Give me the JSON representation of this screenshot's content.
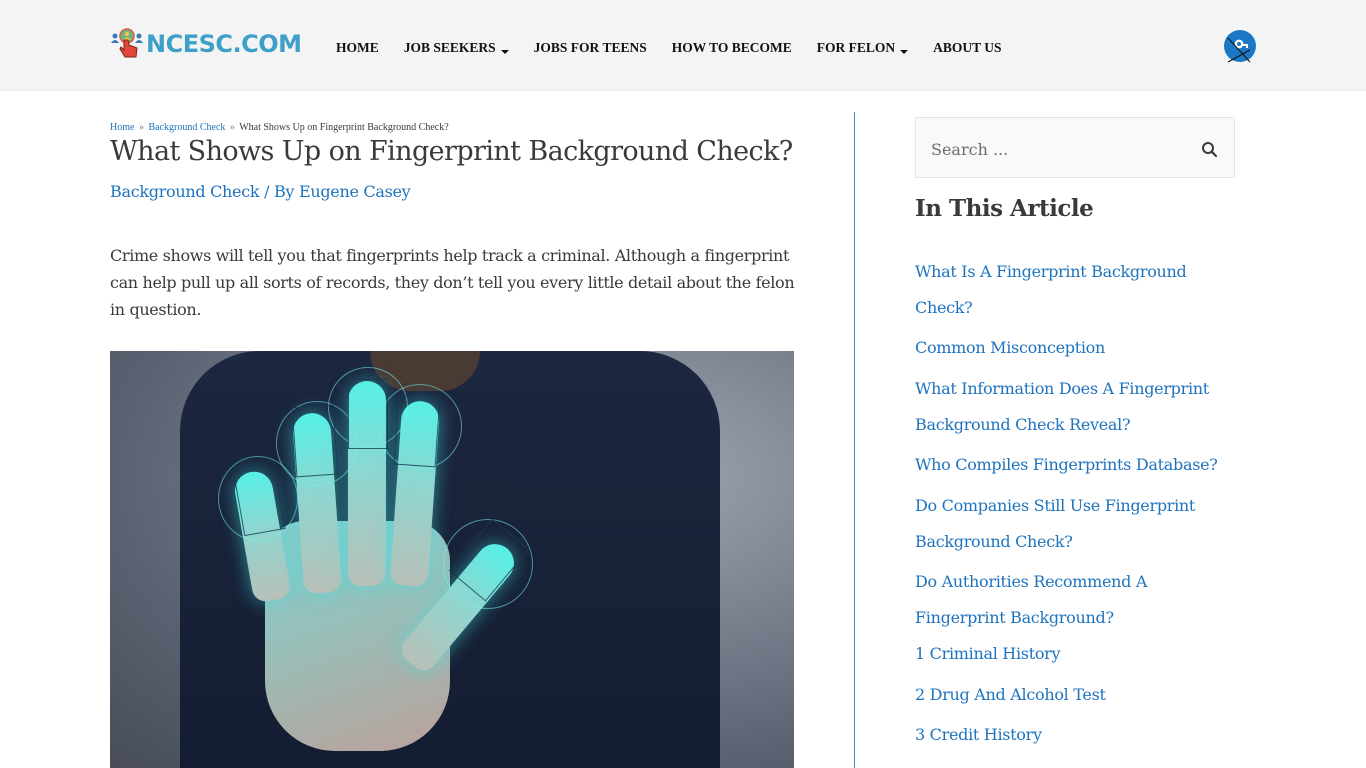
{
  "site": {
    "logo_text": "NCESC.COM",
    "brand_color": "#3ea0c9",
    "link_color": "#1e73be"
  },
  "nav": {
    "items": [
      {
        "label": "HOME",
        "has_dropdown": false
      },
      {
        "label": "JOB SEEKERS",
        "has_dropdown": true
      },
      {
        "label": "JOBS FOR TEENS",
        "has_dropdown": false
      },
      {
        "label": "HOW TO BECOME",
        "has_dropdown": false
      },
      {
        "label": "FOR FELON",
        "has_dropdown": true
      },
      {
        "label": "ABOUT US",
        "has_dropdown": false
      }
    ],
    "account_icon": "user-account-icon"
  },
  "breadcrumb": {
    "items": [
      "Home",
      "Background Check",
      "What Shows Up on Fingerprint Background Check?"
    ],
    "separator": "»"
  },
  "article": {
    "title": "What Shows Up on Fingerprint Background Check?",
    "category": "Background Check",
    "by_prefix": " / By ",
    "author": "Eugene Casey",
    "intro": "Crime shows will tell you that fingerprints help track a criminal. Although a fingerprint can help pull up all sorts of records, they don’t tell you every little detail about the felon in question.",
    "image_alt": "Hand with glowing fingerprint scan"
  },
  "sidebar": {
    "search_placeholder": "Search ...",
    "search_icon": "search-icon",
    "toc_title": "In This Article",
    "toc_items": [
      {
        "label": "What Is A Fingerprint Background Check?"
      },
      {
        "label": "Common Misconception"
      },
      {
        "label": "What Information Does A Fingerprint Background Check Reveal?"
      },
      {
        "label": "Who Compiles Fingerprints Database?"
      },
      {
        "label": "Do Companies Still Use Fingerprint Background Check?"
      },
      {
        "label": "Do Authorities Recommend A Fingerprint Background?"
      },
      {
        "label": "1 Criminal History"
      },
      {
        "label": "2 Drug And Alcohol Test"
      },
      {
        "label": "3 Credit History"
      }
    ]
  }
}
